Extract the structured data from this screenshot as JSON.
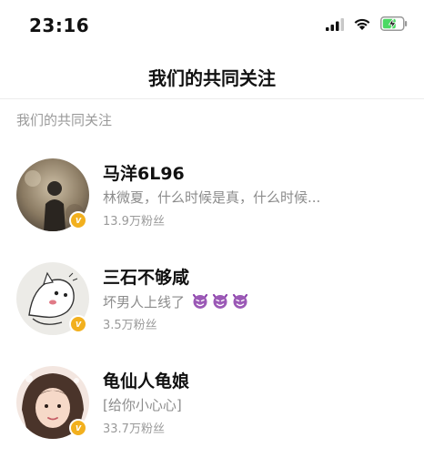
{
  "status_bar": {
    "time": "23:16",
    "icons": [
      "signal-icon",
      "wifi-icon",
      "battery-charging-icon"
    ],
    "battery_color": "#4cd964"
  },
  "nav": {
    "title": "我们的共同关注"
  },
  "section": {
    "header": "我们的共同关注"
  },
  "users": [
    {
      "name": "马洋6L96",
      "description": "林微夏，什么时候是真，什么时候...",
      "fans": "13.9万粉丝",
      "verified": true
    },
    {
      "name": "三石不够咸",
      "description": "坏男人上线了",
      "description_emojis": [
        "devil-emoji",
        "devil-emoji",
        "devil-emoji"
      ],
      "fans": "3.5万粉丝",
      "verified": true
    },
    {
      "name": "龟仙人龟娘",
      "description": "[给你小心心]",
      "fans": "33.7万粉丝",
      "verified": true
    }
  ],
  "verified_badge": {
    "text": "v",
    "color": "#f2b01e"
  }
}
